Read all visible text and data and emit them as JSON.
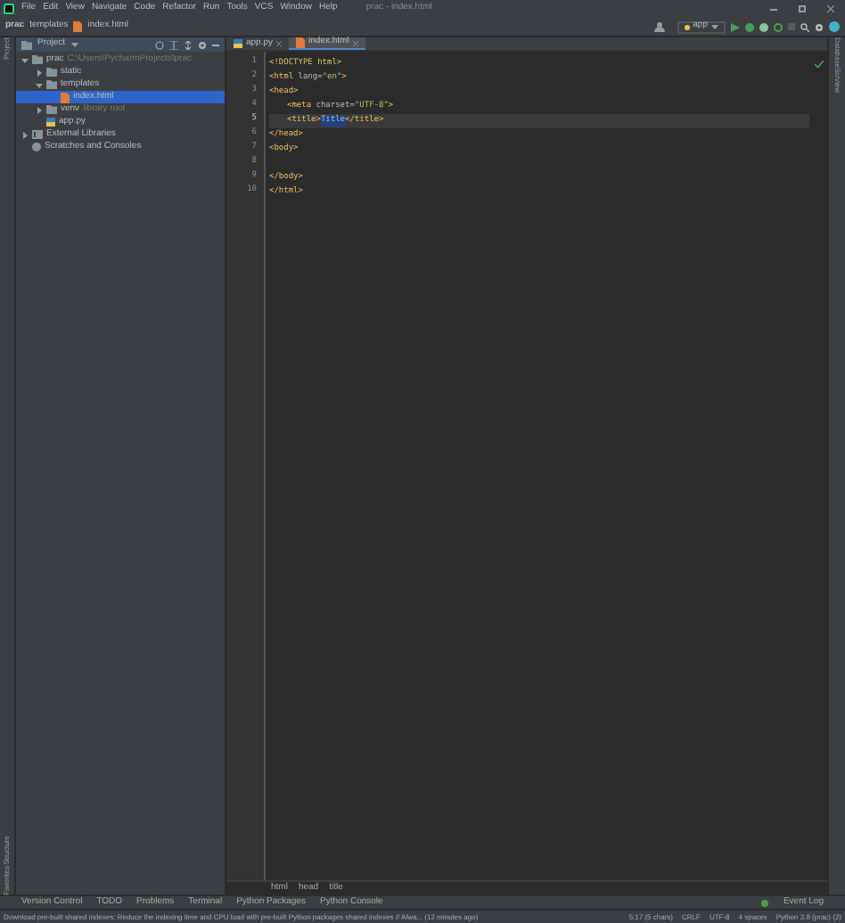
{
  "window": {
    "title": "prac - index.html"
  },
  "menu": [
    "File",
    "Edit",
    "View",
    "Navigate",
    "Code",
    "Refactor",
    "Run",
    "Tools",
    "VCS",
    "Window",
    "Help"
  ],
  "navbar": [
    "prac",
    "templates",
    "index.html"
  ],
  "run_config": "app",
  "project_panel": {
    "title": "Project",
    "tree": [
      {
        "name": "prac",
        "note": "C:\\Users\\PycharmProjects\\prac",
        "kind": "folder",
        "expanded": true,
        "selected": false,
        "children": [
          {
            "name": "static",
            "kind": "folder",
            "expanded": false,
            "selected": false
          },
          {
            "name": "templates",
            "kind": "folder",
            "expanded": true,
            "selected": false,
            "children": [
              {
                "name": "index.html",
                "kind": "html",
                "selected": true
              }
            ]
          },
          {
            "name": "venv",
            "note": "library root",
            "kind": "folder",
            "expanded": false,
            "selected": false
          },
          {
            "name": "app.py",
            "kind": "python",
            "selected": false
          }
        ]
      },
      {
        "name": "External Libraries",
        "kind": "library",
        "expanded": false,
        "selected": false
      },
      {
        "name": "Scratches and Consoles",
        "kind": "scratch",
        "selected": false
      }
    ]
  },
  "editor_tabs": [
    {
      "label": "app.py",
      "kind": "python",
      "selected": false
    },
    {
      "label": "index.html",
      "kind": "html",
      "selected": true
    }
  ],
  "code": [
    {
      "number": "1",
      "current": false,
      "tokens": [
        {
          "kind": "tag",
          "text": "<!DOCTYPE html>"
        }
      ]
    },
    {
      "number": "2",
      "current": false,
      "tokens": [
        {
          "kind": "tag",
          "text": "<html "
        },
        {
          "kind": "attr",
          "text": "lang="
        },
        {
          "kind": "value",
          "text": "\"en\""
        },
        {
          "kind": "tag",
          "text": ">"
        }
      ]
    },
    {
      "number": "3",
      "current": false,
      "tokens": [
        {
          "kind": "tag",
          "text": "<head>"
        }
      ]
    },
    {
      "number": "4",
      "current": false,
      "indent": true,
      "tokens": [
        {
          "kind": "tag",
          "text": "<meta "
        },
        {
          "kind": "attr",
          "text": "charset="
        },
        {
          "kind": "value",
          "text": "\"UTF-8\""
        },
        {
          "kind": "tag",
          "text": ">"
        }
      ]
    },
    {
      "number": "5",
      "current": true,
      "indent": true,
      "tokens": [
        {
          "kind": "tag",
          "text": "<title>"
        },
        {
          "kind": "selection",
          "text": "Title"
        },
        {
          "kind": "tag",
          "text": "</title>"
        }
      ]
    },
    {
      "number": "6",
      "current": false,
      "tokens": [
        {
          "kind": "tag",
          "text": "</head>"
        }
      ]
    },
    {
      "number": "7",
      "current": false,
      "tokens": [
        {
          "kind": "tag",
          "text": "<body>"
        }
      ]
    },
    {
      "number": "8",
      "current": false
    },
    {
      "number": "9",
      "current": false,
      "tokens": [
        {
          "kind": "tag",
          "text": "</body>"
        }
      ]
    },
    {
      "number": "10",
      "current": false,
      "tokens": [
        {
          "kind": "tag",
          "text": "</html>"
        }
      ]
    }
  ],
  "breadcrumbs": [
    "html",
    "head",
    "title"
  ],
  "left_stripe": {
    "top": [
      "Project"
    ],
    "bottom": [
      "Structure",
      "Favorites"
    ]
  },
  "right_stripe": [
    "Database",
    "SciView"
  ],
  "tool_tabs": [
    "Version Control",
    "TODO",
    "Problems",
    "Terminal",
    "Python Packages",
    "Python Console"
  ],
  "event_log": "Event Log",
  "status_bar": {
    "message": "Download pre-built shared indexes: Reduce the indexing time and CPU load with pre-built Python packages shared indexes // Alwa... (12 minutes ago)",
    "items": [
      "5:17 (5 chars)",
      "CRLF",
      "UTF-8",
      "4 spaces",
      "Python 3.8 (prac) (2)"
    ]
  }
}
